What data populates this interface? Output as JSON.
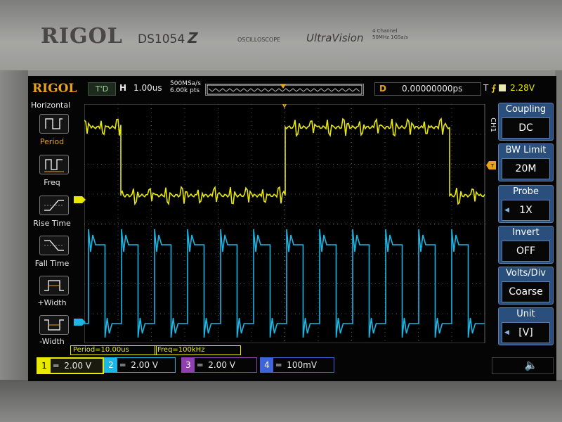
{
  "device": {
    "brand": "RIGOL",
    "model": "DS1054",
    "model_suffix": "Z",
    "type_label": "OSCILLOSCOPE",
    "series": "UltraVision",
    "specs": [
      "4 Channel",
      "50MHz  1GSa/s"
    ]
  },
  "topbar": {
    "logo": "RIGOL",
    "run_status": "T'D",
    "timebase_label": "H",
    "timebase_value": "1.00us",
    "sample_rate": "500MSa/s",
    "memory_depth": "6.00k pts",
    "delay_label": "D",
    "delay_value": "0.00000000ps",
    "trigger_label": "T",
    "trigger_level": "2.28V",
    "trigger_marker": "T",
    "level_marker": "T"
  },
  "left_menu": {
    "title": "Horizontal",
    "items": [
      {
        "label": "Period",
        "icon": "period-icon"
      },
      {
        "label": "Freq",
        "icon": "frequency-icon"
      },
      {
        "label": "Rise Time",
        "icon": "rise-time-icon"
      },
      {
        "label": "Fall Time",
        "icon": "fall-time-icon"
      },
      {
        "label": "+Width",
        "icon": "positive-width-icon"
      },
      {
        "label": "-Width",
        "icon": "negative-width-icon"
      }
    ]
  },
  "right_menu": {
    "channel_tag": "CH1",
    "items": [
      {
        "title": "Coupling",
        "value": "DC"
      },
      {
        "title": "BW Limit",
        "value": "20M"
      },
      {
        "title": "Probe",
        "value": "1X"
      },
      {
        "title": "Invert",
        "value": "OFF"
      },
      {
        "title": "Volts/Div",
        "value": "Coarse"
      },
      {
        "title": "Unit",
        "value": "[V]"
      }
    ]
  },
  "measurements": {
    "period": "Period=10.00us",
    "freq": "Freq=100kHz"
  },
  "channels": [
    {
      "num": "1",
      "coupling": "═",
      "scale": "2.00 V",
      "color": "#e8e800"
    },
    {
      "num": "2",
      "coupling": "═",
      "scale": "2.00 V",
      "color": "#19b7e6"
    },
    {
      "num": "3",
      "coupling": "═",
      "scale": "2.00 V",
      "color": "#8e3fb0"
    },
    {
      "num": "4",
      "coupling": "═",
      "scale": "100mV",
      "color": "#3d64d8"
    }
  ],
  "colors": {
    "ch1": "#e8e800",
    "ch2": "#19b7e6",
    "accent": "#e8a21c",
    "menu_blue": "#2a4f7c"
  },
  "speaker_icon": "speaker-icon"
}
